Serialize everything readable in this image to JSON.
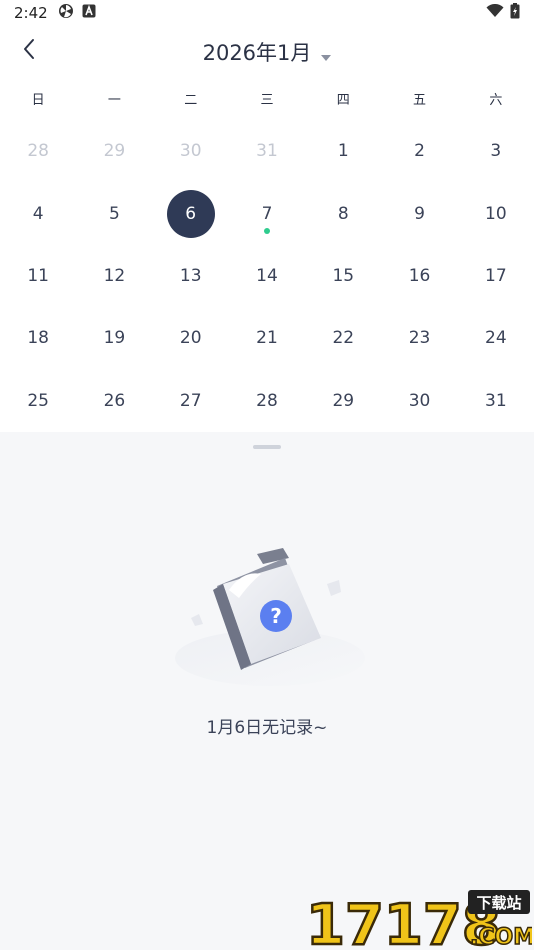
{
  "status_bar": {
    "time": "2:42",
    "icons": [
      "fan-icon",
      "a-badge-icon"
    ],
    "right_icons": [
      "wifi-icon",
      "battery-icon"
    ]
  },
  "header": {
    "back_icon": "chevron-left-icon",
    "title": "2026年1月",
    "dropdown_icon": "caret-down-icon"
  },
  "calendar": {
    "weekdays": [
      "日",
      "一",
      "二",
      "三",
      "四",
      "五",
      "六"
    ],
    "days": [
      {
        "label": "28",
        "muted": true
      },
      {
        "label": "29",
        "muted": true
      },
      {
        "label": "30",
        "muted": true
      },
      {
        "label": "31",
        "muted": true
      },
      {
        "label": "1"
      },
      {
        "label": "2"
      },
      {
        "label": "3"
      },
      {
        "label": "4"
      },
      {
        "label": "5"
      },
      {
        "label": "6",
        "selected": true
      },
      {
        "label": "7",
        "has_record": true
      },
      {
        "label": "8"
      },
      {
        "label": "9"
      },
      {
        "label": "10"
      },
      {
        "label": "11"
      },
      {
        "label": "12"
      },
      {
        "label": "13"
      },
      {
        "label": "14"
      },
      {
        "label": "15"
      },
      {
        "label": "16"
      },
      {
        "label": "17"
      },
      {
        "label": "18"
      },
      {
        "label": "19"
      },
      {
        "label": "20"
      },
      {
        "label": "21"
      },
      {
        "label": "22"
      },
      {
        "label": "23"
      },
      {
        "label": "24"
      },
      {
        "label": "25"
      },
      {
        "label": "26"
      },
      {
        "label": "27"
      },
      {
        "label": "28"
      },
      {
        "label": "29"
      },
      {
        "label": "30"
      },
      {
        "label": "31"
      }
    ],
    "selected_color": "#2f3a56",
    "record_dot_color": "#2ecc8e"
  },
  "empty_state": {
    "icon": "question-folder-icon",
    "message": "1月6日无记录~"
  },
  "watermark": {
    "number": "17178",
    "tag": "下载站",
    "suffix": ".COM"
  }
}
